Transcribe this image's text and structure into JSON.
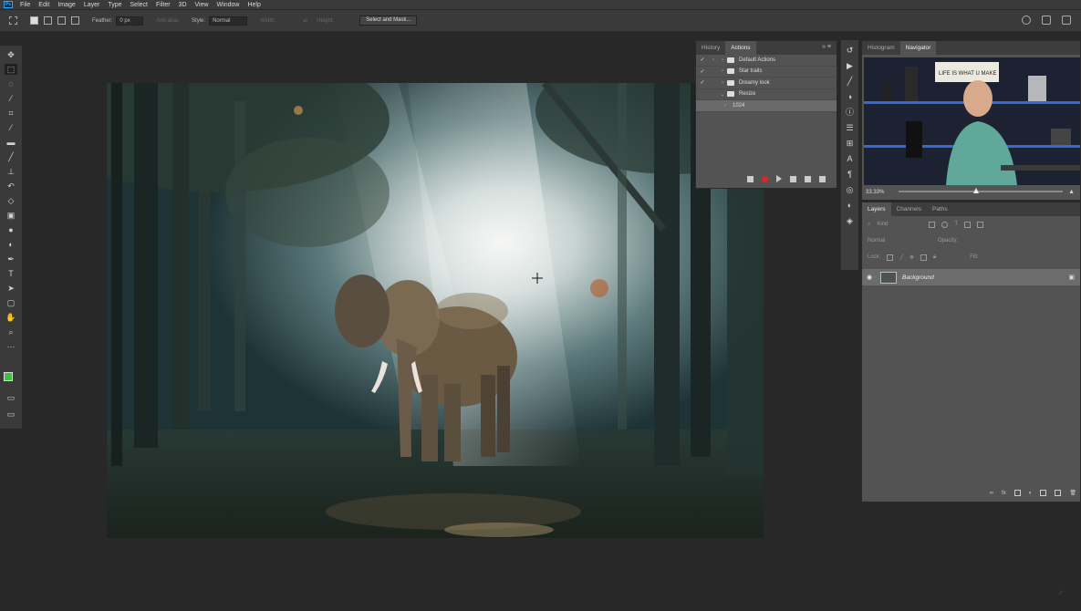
{
  "app": {
    "logo_text": "Ps"
  },
  "menu": [
    "File",
    "Edit",
    "Image",
    "Layer",
    "Type",
    "Select",
    "Filter",
    "3D",
    "View",
    "Window",
    "Help"
  ],
  "options_bar": {
    "feather_label": "Feather:",
    "feather_value": "0 px",
    "antialias_label": "Anti-alias",
    "style_label": "Style:",
    "style_value": "Normal",
    "width_label": "Width:",
    "height_label": "Height:",
    "select_mask_button": "Select and Mask..."
  },
  "colors": {
    "foreground": "#3ec23e",
    "background": "#ffffff",
    "record": "#e32222"
  },
  "actions_panel": {
    "tabs": [
      {
        "label": "History",
        "active": false
      },
      {
        "label": "Actions",
        "active": true
      }
    ],
    "items": [
      {
        "label": "Default Actions",
        "checked": true,
        "type": "folder"
      },
      {
        "label": "Star trails",
        "checked": true,
        "type": "folder"
      },
      {
        "label": "Dreamy look",
        "checked": true,
        "type": "folder"
      },
      {
        "label": "Resize",
        "checked": false,
        "type": "folder"
      },
      {
        "label": "1024",
        "checked": false,
        "type": "action",
        "selected": true
      }
    ]
  },
  "navigator_panel": {
    "tabs": [
      {
        "label": "Histogram",
        "active": false
      },
      {
        "label": "Navigator",
        "active": true
      }
    ],
    "zoom": "33.33%",
    "thumb_sign_text": "LIFE IS WHAT U MAKE"
  },
  "layers_panel": {
    "tabs": [
      {
        "label": "Layers",
        "active": true
      },
      {
        "label": "Channels",
        "active": false
      },
      {
        "label": "Paths",
        "active": false
      }
    ],
    "kind_label": "Kind",
    "blend_mode": "Normal",
    "opacity_label": "Opacity:",
    "lock_label": "Lock:",
    "fill_label": "Fill:",
    "layers": [
      {
        "name": "Background",
        "visible": true,
        "locked": true
      }
    ]
  }
}
